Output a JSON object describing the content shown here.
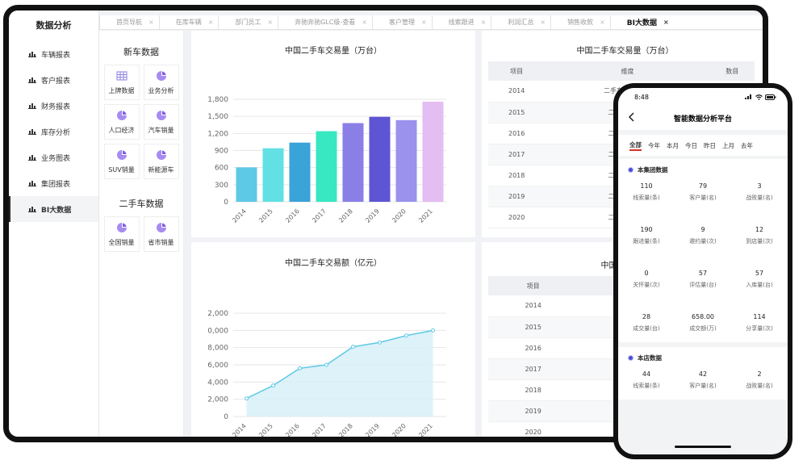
{
  "sidebar": {
    "title": "数据分析",
    "items": [
      {
        "label": "车辆报表"
      },
      {
        "label": "客户报表"
      },
      {
        "label": "财务报表"
      },
      {
        "label": "库存分析"
      },
      {
        "label": "业务图表"
      },
      {
        "label": "集团报表"
      },
      {
        "label": "BI大数据",
        "active": true
      }
    ]
  },
  "tabs": [
    {
      "label": "首页导航"
    },
    {
      "label": "在库车辆"
    },
    {
      "label": "部门员工"
    },
    {
      "label": "奔驰奔驰GLC级-查看"
    },
    {
      "label": "客户管理"
    },
    {
      "label": "线索跟进"
    },
    {
      "label": "利润汇总"
    },
    {
      "label": "销售收款"
    },
    {
      "label": "BI大数据",
      "active": true
    }
  ],
  "categories": {
    "new_car": {
      "title": "新车数据",
      "items": [
        {
          "label": "上牌数据",
          "icon": "table-icon"
        },
        {
          "label": "业务分析",
          "icon": "pie-icon"
        },
        {
          "label": "人口经济",
          "icon": "pie-icon"
        },
        {
          "label": "汽车销量",
          "icon": "pie-icon"
        },
        {
          "label": "SUV销量",
          "icon": "pie-icon"
        },
        {
          "label": "新能源车",
          "icon": "pie-icon"
        }
      ]
    },
    "used_car": {
      "title": "二手车数据",
      "items": [
        {
          "label": "全国销量",
          "icon": "pie-icon"
        },
        {
          "label": "省市销量",
          "icon": "pie-icon"
        }
      ]
    }
  },
  "charts": {
    "bar_title": "中国二手车交易量（万台）",
    "area_title": "中国二手车交易额（亿元）"
  },
  "chart_data": [
    {
      "type": "bar",
      "title": "中国二手车交易量（万台）",
      "categories": [
        "2014",
        "2015",
        "2016",
        "2017",
        "2018",
        "2019",
        "2020",
        "2021"
      ],
      "values": [
        605,
        940,
        1039,
        1240,
        1382,
        1492,
        1434,
        1758
      ],
      "colors": [
        "#5ec9e6",
        "#62e0e3",
        "#3aa3d8",
        "#38e8c1",
        "#8a7fe6",
        "#5d55d4",
        "#9a92ec",
        "#e4bdf2"
      ],
      "yticks": [
        "0",
        "300",
        "600",
        "900",
        "1,200",
        "1,500",
        "1,800"
      ],
      "ylim": [
        0,
        1800
      ]
    },
    {
      "type": "area",
      "title": "中国二手车交易额（亿元）",
      "categories": [
        "2014",
        "2015",
        "2016",
        "2017",
        "2018",
        "2019",
        "2020",
        "2021"
      ],
      "values": [
        2100,
        3600,
        5600,
        6000,
        8100,
        8600,
        9400,
        10000
      ],
      "yticks": [
        "0",
        "2,000",
        "4,000",
        "6,000",
        "8,000",
        "0,000",
        "2,000"
      ],
      "ylim": [
        0,
        12000
      ],
      "color": "#5ec9e6"
    }
  ],
  "table1": {
    "title": "中国二手车交易量（万台）",
    "headers": [
      "项目",
      "维度",
      "数目"
    ],
    "rows": [
      [
        "2014",
        "二手车交易量(万",
        ""
      ],
      [
        "2015",
        "二手车交易量",
        ""
      ],
      [
        "2016",
        "二手车交易量",
        ""
      ],
      [
        "2017",
        "二手车交易量",
        ""
      ],
      [
        "2018",
        "二手车交易量",
        ""
      ],
      [
        "2019",
        "二手车交易量",
        ""
      ],
      [
        "2020",
        "二手车交易量",
        ""
      ]
    ]
  },
  "table2": {
    "title": "中国二手车交",
    "headers": [
      "项目",
      "维度"
    ],
    "rows": [
      [
        "2014",
        "二手车交易"
      ],
      [
        "2015",
        "二手车交易"
      ],
      [
        "2016",
        "二手车交易"
      ],
      [
        "2017",
        "二手车交易"
      ],
      [
        "2018",
        "二手车交易"
      ],
      [
        "2019",
        "二手车交易"
      ],
      [
        "2020",
        "二手车交易"
      ]
    ]
  },
  "phone": {
    "time": "8:48",
    "title": "智能数据分析平台",
    "filters": [
      {
        "label": "全部",
        "active": true
      },
      {
        "label": "今年"
      },
      {
        "label": "本月"
      },
      {
        "label": "今日"
      },
      {
        "label": "昨日"
      },
      {
        "label": "上月"
      },
      {
        "label": "去年"
      }
    ],
    "group": {
      "title": "本集团数据",
      "stats": [
        {
          "value": "110",
          "label": "线索量(条)"
        },
        {
          "value": "79",
          "label": "客户量(名)"
        },
        {
          "value": "3",
          "label": "战败量(名)"
        },
        {
          "value": "190",
          "label": "跟进量(条)"
        },
        {
          "value": "9",
          "label": "邀约量(次)"
        },
        {
          "value": "12",
          "label": "到店量(次)"
        },
        {
          "value": "0",
          "label": "关怀量(次)"
        },
        {
          "value": "57",
          "label": "评估量(台)"
        },
        {
          "value": "57",
          "label": "入库量(台)"
        },
        {
          "value": "28",
          "label": "成交量(台)"
        },
        {
          "value": "658.00",
          "label": "成交额(万)"
        },
        {
          "value": "114",
          "label": "分享量(次)"
        }
      ]
    },
    "store": {
      "title": "本店数据",
      "stats": [
        {
          "value": "44",
          "label": "线索量(条)"
        },
        {
          "value": "42",
          "label": "客户量(名)"
        },
        {
          "value": "2",
          "label": "战败量(名)"
        }
      ]
    }
  }
}
